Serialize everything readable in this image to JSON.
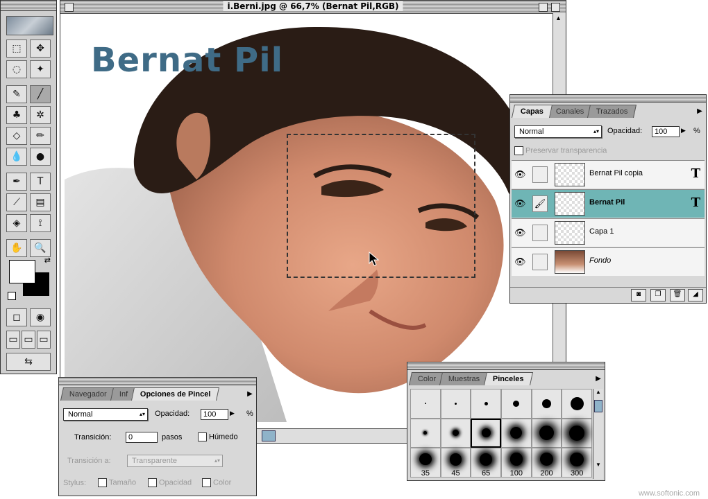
{
  "document": {
    "title": "i.Berni.jpg @ 66,7% (Bernat Pil,RGB)",
    "canvas_title": "Bernat Pil"
  },
  "toolbox": {
    "tools": [
      {
        "name": "marquee-tool",
        "glyph": "⬚",
        "active": false
      },
      {
        "name": "move-tool",
        "glyph": "✥",
        "active": false
      },
      {
        "name": "lasso-tool",
        "glyph": "◌",
        "active": false
      },
      {
        "name": "magic-wand-tool",
        "glyph": "✦",
        "active": false
      },
      {
        "name": "airbrush-tool",
        "glyph": "✎",
        "active": false
      },
      {
        "name": "paintbrush-tool",
        "glyph": "╱",
        "active": true
      },
      {
        "name": "rubber-stamp-tool",
        "glyph": "♣",
        "active": false
      },
      {
        "name": "history-brush-tool",
        "glyph": "✲",
        "active": false
      },
      {
        "name": "eraser-tool",
        "glyph": "◇",
        "active": false
      },
      {
        "name": "pencil-tool",
        "glyph": "✏",
        "active": false
      },
      {
        "name": "blur-tool",
        "glyph": "💧",
        "active": false
      },
      {
        "name": "burn-tool",
        "glyph": "●",
        "active": false
      },
      {
        "name": "pen-tool",
        "glyph": "✒",
        "active": false
      },
      {
        "name": "type-tool",
        "glyph": "T",
        "active": false
      },
      {
        "name": "measure-tool",
        "glyph": "⟋",
        "active": false
      },
      {
        "name": "gradient-tool",
        "glyph": "▤",
        "active": false
      },
      {
        "name": "paint-bucket-tool",
        "glyph": "◈",
        "active": false
      },
      {
        "name": "eyedropper-tool",
        "glyph": "⟟",
        "active": false
      },
      {
        "name": "hand-tool",
        "glyph": "✋",
        "active": false
      },
      {
        "name": "zoom-tool",
        "glyph": "🔍",
        "active": false
      }
    ]
  },
  "layers_palette": {
    "tabs": [
      "Capas",
      "Canales",
      "Trazados"
    ],
    "blend_mode": "Normal",
    "opacity_label": "Opacidad:",
    "opacity_value": "100",
    "percent": "%",
    "preserve_label": "Preservar transparencia",
    "layers": [
      {
        "name": "Bernat Pil copia",
        "type": "T",
        "selected": false,
        "photo": false,
        "style": "normal",
        "link": ""
      },
      {
        "name": "Bernat Pil",
        "type": "T",
        "selected": true,
        "photo": false,
        "style": "bold",
        "link": "🖌"
      },
      {
        "name": "Capa 1",
        "type": "",
        "selected": false,
        "photo": false,
        "style": "normal",
        "link": ""
      },
      {
        "name": "Fondo",
        "type": "",
        "selected": false,
        "photo": true,
        "style": "italic",
        "link": ""
      }
    ]
  },
  "options_palette": {
    "tabs": [
      "Navegador",
      "Inf",
      "Opciones de Pincel"
    ],
    "mode": "Normal",
    "opacity_label": "Opacidad:",
    "opacity_value": "100",
    "percent": "%",
    "transition_label": "Transición:",
    "transition_value": "0",
    "steps_label": "pasos",
    "wet_label": "Húmedo",
    "transition_to_label": "Transición a:",
    "transition_to_value": "Transparente",
    "stylus_label": "Stylus:",
    "stylus_size": "Tamaño",
    "stylus_opacity": "Opacidad",
    "stylus_color": "Color"
  },
  "brushes_palette": {
    "tabs": [
      "Color",
      "Muestras",
      "Pinceles"
    ],
    "brushes": [
      {
        "size": 1,
        "soft": false,
        "label": ""
      },
      {
        "size": 3,
        "soft": false,
        "label": ""
      },
      {
        "size": 5,
        "soft": false,
        "label": ""
      },
      {
        "size": 9,
        "soft": false,
        "label": ""
      },
      {
        "size": 13,
        "soft": false,
        "label": ""
      },
      {
        "size": 19,
        "soft": false,
        "label": ""
      },
      {
        "size": 5,
        "soft": true,
        "label": ""
      },
      {
        "size": 9,
        "soft": true,
        "label": ""
      },
      {
        "size": 13,
        "soft": true,
        "label": "",
        "selected": true
      },
      {
        "size": 17,
        "soft": true,
        "label": ""
      },
      {
        "size": 21,
        "soft": true,
        "label": ""
      },
      {
        "size": 27,
        "soft": true,
        "label": ""
      },
      {
        "size": 35,
        "soft": true,
        "label": "35"
      },
      {
        "size": 45,
        "soft": true,
        "label": "45"
      },
      {
        "size": 65,
        "soft": true,
        "label": "65"
      },
      {
        "size": 100,
        "soft": true,
        "label": "100"
      },
      {
        "size": 200,
        "soft": true,
        "label": "200"
      },
      {
        "size": 300,
        "soft": true,
        "label": "300"
      }
    ]
  },
  "watermark": "www.softonic.com"
}
